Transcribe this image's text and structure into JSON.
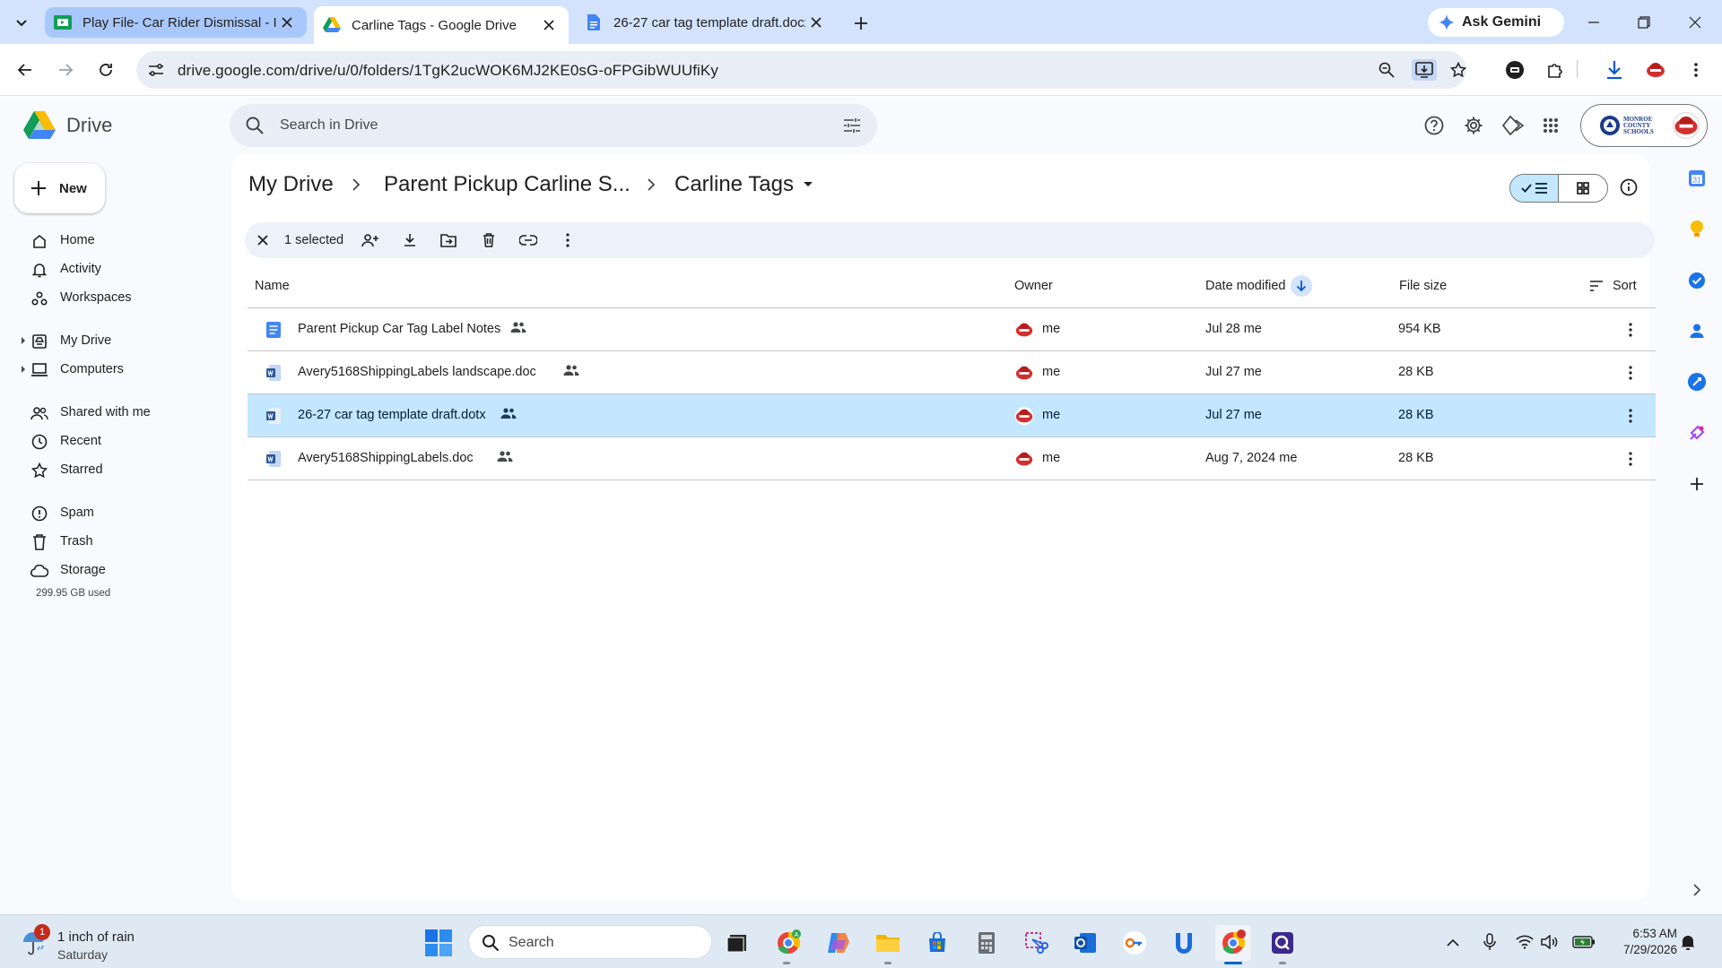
{
  "browser": {
    "tabs": [
      {
        "title": "Play File- Car Rider Dismissal - I",
        "favicon": "google-sheets-green"
      },
      {
        "title": "Carline Tags - Google Drive",
        "favicon": "google-drive"
      },
      {
        "title": "26-27 car tag template draft.docx",
        "favicon": "google-docs"
      }
    ],
    "ask_gemini": "Ask Gemini",
    "url": "drive.google.com/drive/u/0/folders/1TgK2ucWOK6MJ2KE0sG-oFPGibWUUfiKy"
  },
  "drive": {
    "app_name": "Drive",
    "search_placeholder": "Search in Drive",
    "account_org": [
      "MONROE",
      "COUNTY",
      "SCHOOLS"
    ],
    "new_label": "New",
    "nav": [
      {
        "label": "Home",
        "icon": "home-icon"
      },
      {
        "label": "Activity",
        "icon": "bell-icon"
      },
      {
        "label": "Workspaces",
        "icon": "workspaces-icon"
      },
      {
        "label": "My Drive",
        "icon": "my-drive-icon"
      },
      {
        "label": "Computers",
        "icon": "computer-icon"
      },
      {
        "label": "Shared with me",
        "icon": "people-icon"
      },
      {
        "label": "Recent",
        "icon": "clock-icon"
      },
      {
        "label": "Starred",
        "icon": "star-icon"
      },
      {
        "label": "Spam",
        "icon": "spam-icon"
      },
      {
        "label": "Trash",
        "icon": "trash-icon"
      },
      {
        "label": "Storage",
        "icon": "cloud-icon"
      }
    ],
    "storage_used": "299.95 GB used",
    "breadcrumb": [
      "My Drive",
      "Parent Pickup Carline S...",
      "Carline Tags"
    ],
    "selection_count": "1 selected",
    "columns": {
      "name": "Name",
      "owner": "Owner",
      "date": "Date modified",
      "size": "File size",
      "sort": "Sort"
    },
    "files": [
      {
        "name": "Parent Pickup Car Tag Label Notes",
        "type": "google-doc",
        "owner": "me",
        "modified": "Jul 28 me",
        "size": "954 KB",
        "selected": false
      },
      {
        "name": "Avery5168ShippingLabels landscape.doc",
        "type": "word",
        "owner": "me",
        "modified": "Jul 27 me",
        "size": "28 KB",
        "selected": false
      },
      {
        "name": "26-27 car tag template draft.dotx",
        "type": "word",
        "owner": "me",
        "modified": "Jul 27 me",
        "size": "28 KB",
        "selected": true
      },
      {
        "name": "Avery5168ShippingLabels.doc",
        "type": "word",
        "owner": "me",
        "modified": "Aug 7, 2024 me",
        "size": "28 KB",
        "selected": false
      }
    ]
  },
  "taskbar": {
    "weather_badge": "1",
    "weather_line1": "1 inch of rain",
    "weather_line2": "Saturday",
    "search_label": "Search",
    "time": "6:53 AM",
    "date": "7/29/2026"
  },
  "colors": {
    "accent": "#0b57d0",
    "selected_row": "#c2e7ff",
    "drive_bg": "#f8fafd",
    "tab_strip": "#d3e3fd"
  }
}
